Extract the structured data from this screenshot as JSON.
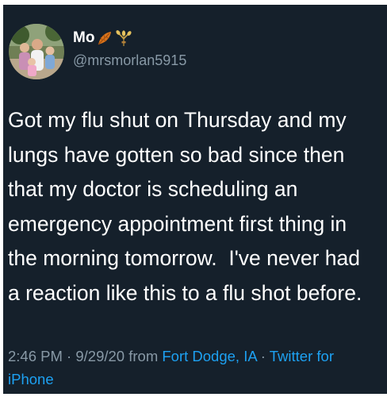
{
  "user": {
    "display_name": "Mo",
    "handle": "@mrsmorlan5915",
    "emojis": [
      "fallen-leaf-emoji",
      "sheaf-of-rice-emoji"
    ]
  },
  "tweet": {
    "lines": [
      "Got my flu shut on Thursday and my",
      "lungs have gotten so bad since then",
      "that my doctor is scheduling an",
      "emergency appointment first thing in",
      "the morning tomorrow.  I've never had",
      "a reaction like this to a flu shot before."
    ]
  },
  "meta": {
    "time": "2:46 PM",
    "separator": " · ",
    "date": "9/29/20",
    "from": " from ",
    "location": "Fort Dodge, IA",
    "separator2": " · ",
    "client_part1": "Twitter for",
    "client_part2": "iPhone"
  },
  "colors": {
    "background": "#15202b",
    "text": "#ffffff",
    "secondary": "#8899a6",
    "link": "#1da1f2"
  }
}
